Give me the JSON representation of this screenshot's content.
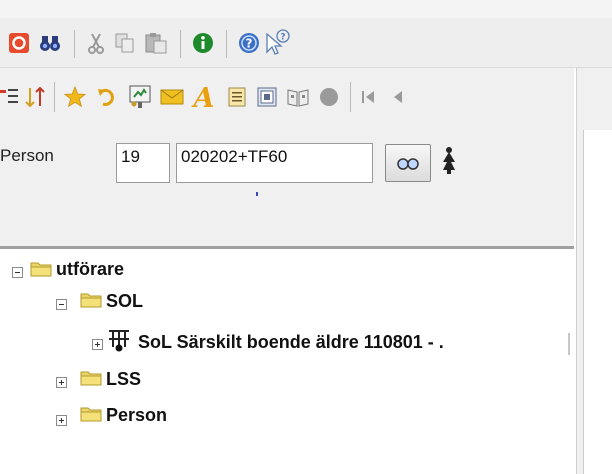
{
  "toolbar_top": {
    "icons": [
      "record-icon",
      "binoculars-icon",
      "cut-icon",
      "copy-icon",
      "paste-icon",
      "info-icon",
      "help-icon",
      "context-help-icon"
    ]
  },
  "toolbar_second": {
    "icons": [
      "indent-icon",
      "sort-icon",
      "star-icon",
      "undo-icon",
      "presentation-icon",
      "mail-icon",
      "font-icon",
      "document-icon",
      "grid-icon",
      "book-icon",
      "circle-icon",
      "first-icon",
      "previous-icon"
    ]
  },
  "person_form": {
    "label": "Person",
    "number_value": "19",
    "id_value": "020202+TF60"
  },
  "tree": {
    "root": {
      "label": "utförare",
      "state": "expanded"
    },
    "items": [
      {
        "label": "SOL",
        "state": "expanded"
      },
      {
        "label": "SoL Särskilt boende äldre 110801 - ."
      },
      {
        "label": "LSS",
        "state": "collapsed"
      },
      {
        "label": "Person",
        "state": "collapsed"
      }
    ]
  },
  "colors": {
    "folder": "#e9d56a",
    "record_red": "#e84a2c",
    "info_green": "#1e8a2c",
    "help_blue": "#3a6fc4"
  }
}
